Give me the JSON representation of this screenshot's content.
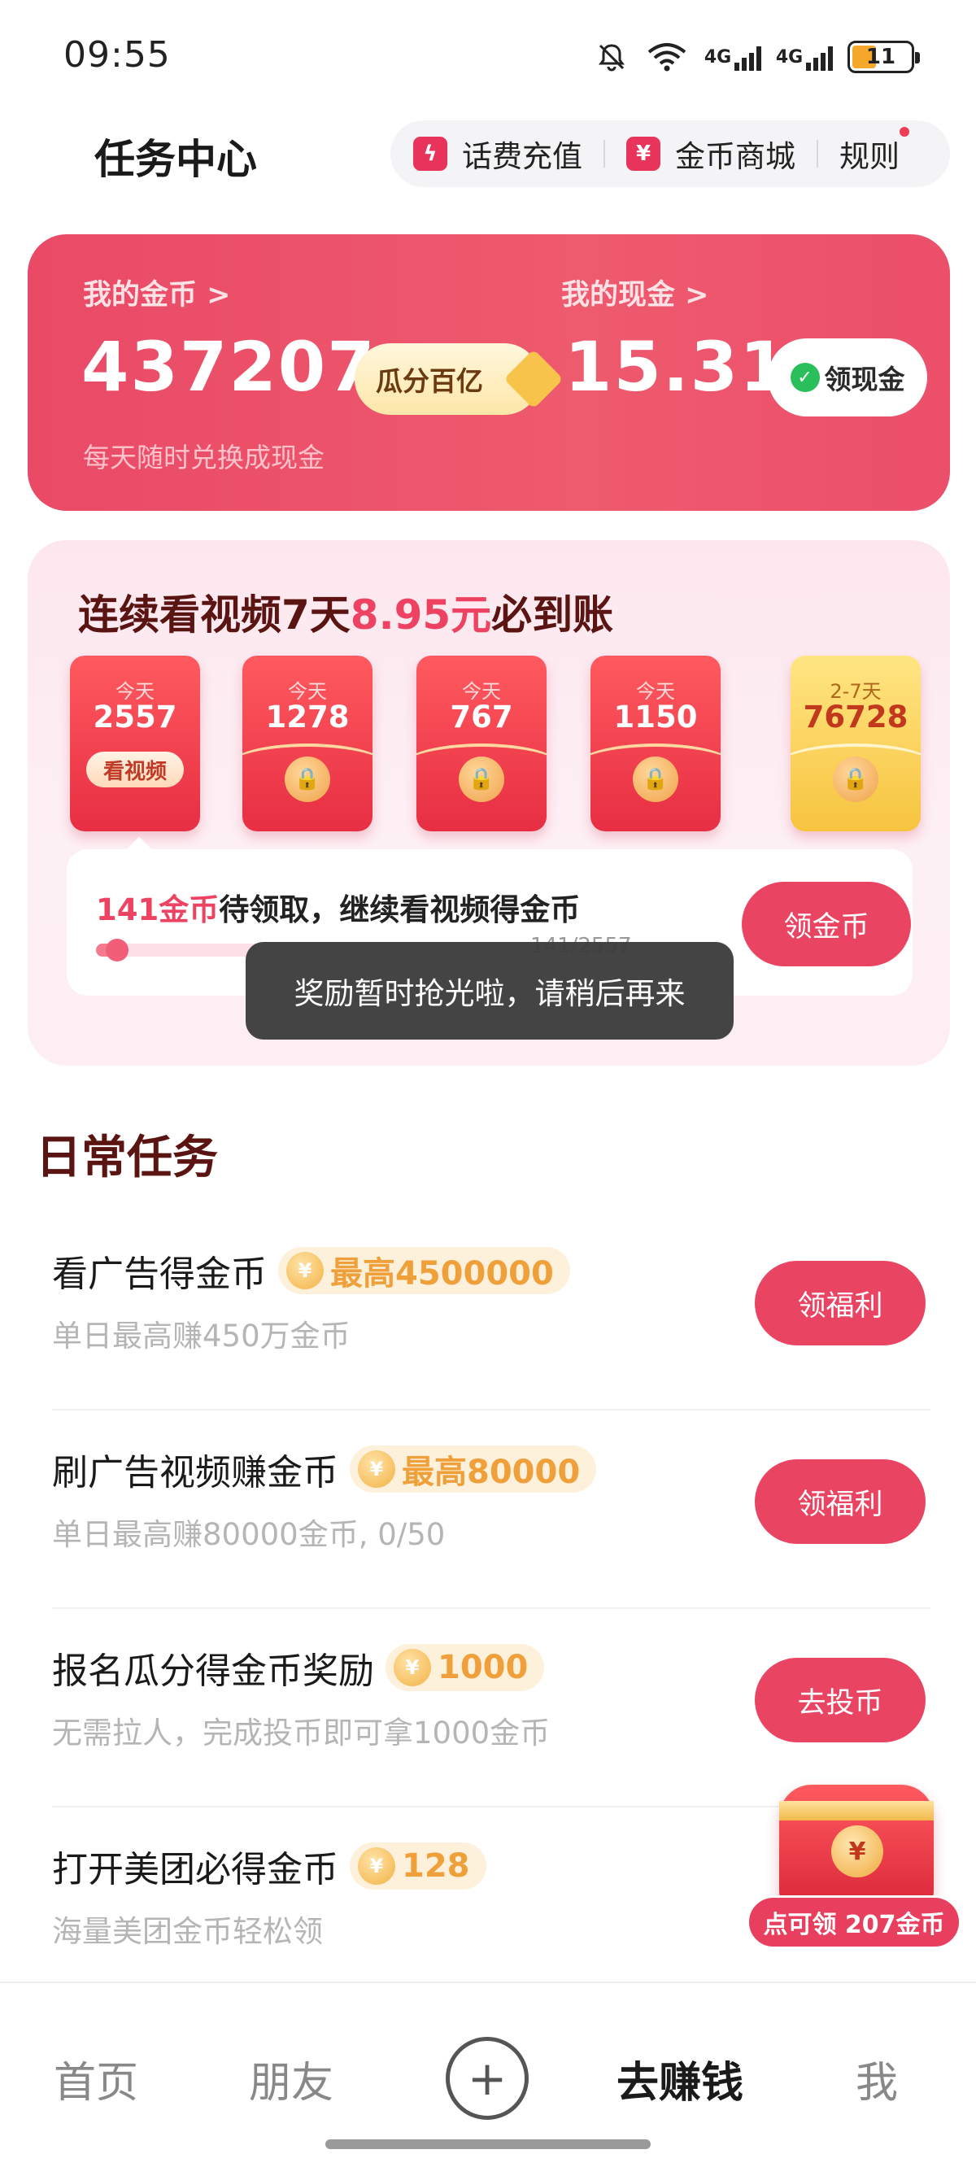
{
  "status_bar": {
    "time": "09:55",
    "net1": "4G",
    "net2": "4G",
    "battery": "11",
    "icons": [
      "bell-muted-icon",
      "wifi-icon",
      "signal-icon",
      "signal-icon",
      "battery-icon"
    ]
  },
  "header": {
    "title": "任务中心",
    "recharge_label": "话费充值",
    "mall_label": "金币商城",
    "rules_label": "规则"
  },
  "wallet": {
    "coins_label": "我的金币 >",
    "coins_value": "437207",
    "coins_sub": "每天随时兑换成现金",
    "promo_label": "瓜分百亿",
    "cash_label": "我的现金 >",
    "cash_value": "15.31",
    "cash_button": "领现金"
  },
  "streak": {
    "title_part1": "连续看视频7天",
    "title_highlight": "8.95元",
    "title_part2": "必到账",
    "envelopes": [
      {
        "day": "今天",
        "amount": "2557",
        "tag": "看视频"
      },
      {
        "day": "今天",
        "amount": "1278"
      },
      {
        "day": "今天",
        "amount": "767"
      },
      {
        "day": "今天",
        "amount": "1150"
      },
      {
        "day": "2-7天",
        "amount": "76728"
      }
    ],
    "claim_highlight": "141金币",
    "claim_text": "待领取，继续看视频得金币",
    "progress_text": "141/2557",
    "progress_fraction": 0.055,
    "claim_button": "领金币"
  },
  "toast": "奖励暂时抢光啦，请稍后再来",
  "daily": {
    "section_title": "日常任务",
    "tasks": [
      {
        "title": "看广告得金币",
        "badge": "最高4500000",
        "subtitle": "单日最高赚450万金币",
        "button": "领福利"
      },
      {
        "title": "刷广告视频赚金币",
        "badge": "最高80000",
        "subtitle": "单日最高赚80000金币, 0/50",
        "button": "领福利"
      },
      {
        "title": "报名瓜分得金币奖励",
        "badge": "1000",
        "subtitle": "无需拉人，完成投币即可拿1000金币",
        "button": "去投币"
      },
      {
        "title": "打开美团必得金币",
        "badge": "128",
        "subtitle": "海量美团金币轻松领",
        "button": ""
      }
    ]
  },
  "float_reward": {
    "label": "点可领 207金币"
  },
  "bottom_nav": {
    "home": "首页",
    "friends": "朋友",
    "plus": "+",
    "earn": "去赚钱",
    "me": "我"
  },
  "colors": {
    "accent": "#ea4463",
    "title_dark_red": "#5a1411",
    "coin_orange": "#f0a03a"
  }
}
